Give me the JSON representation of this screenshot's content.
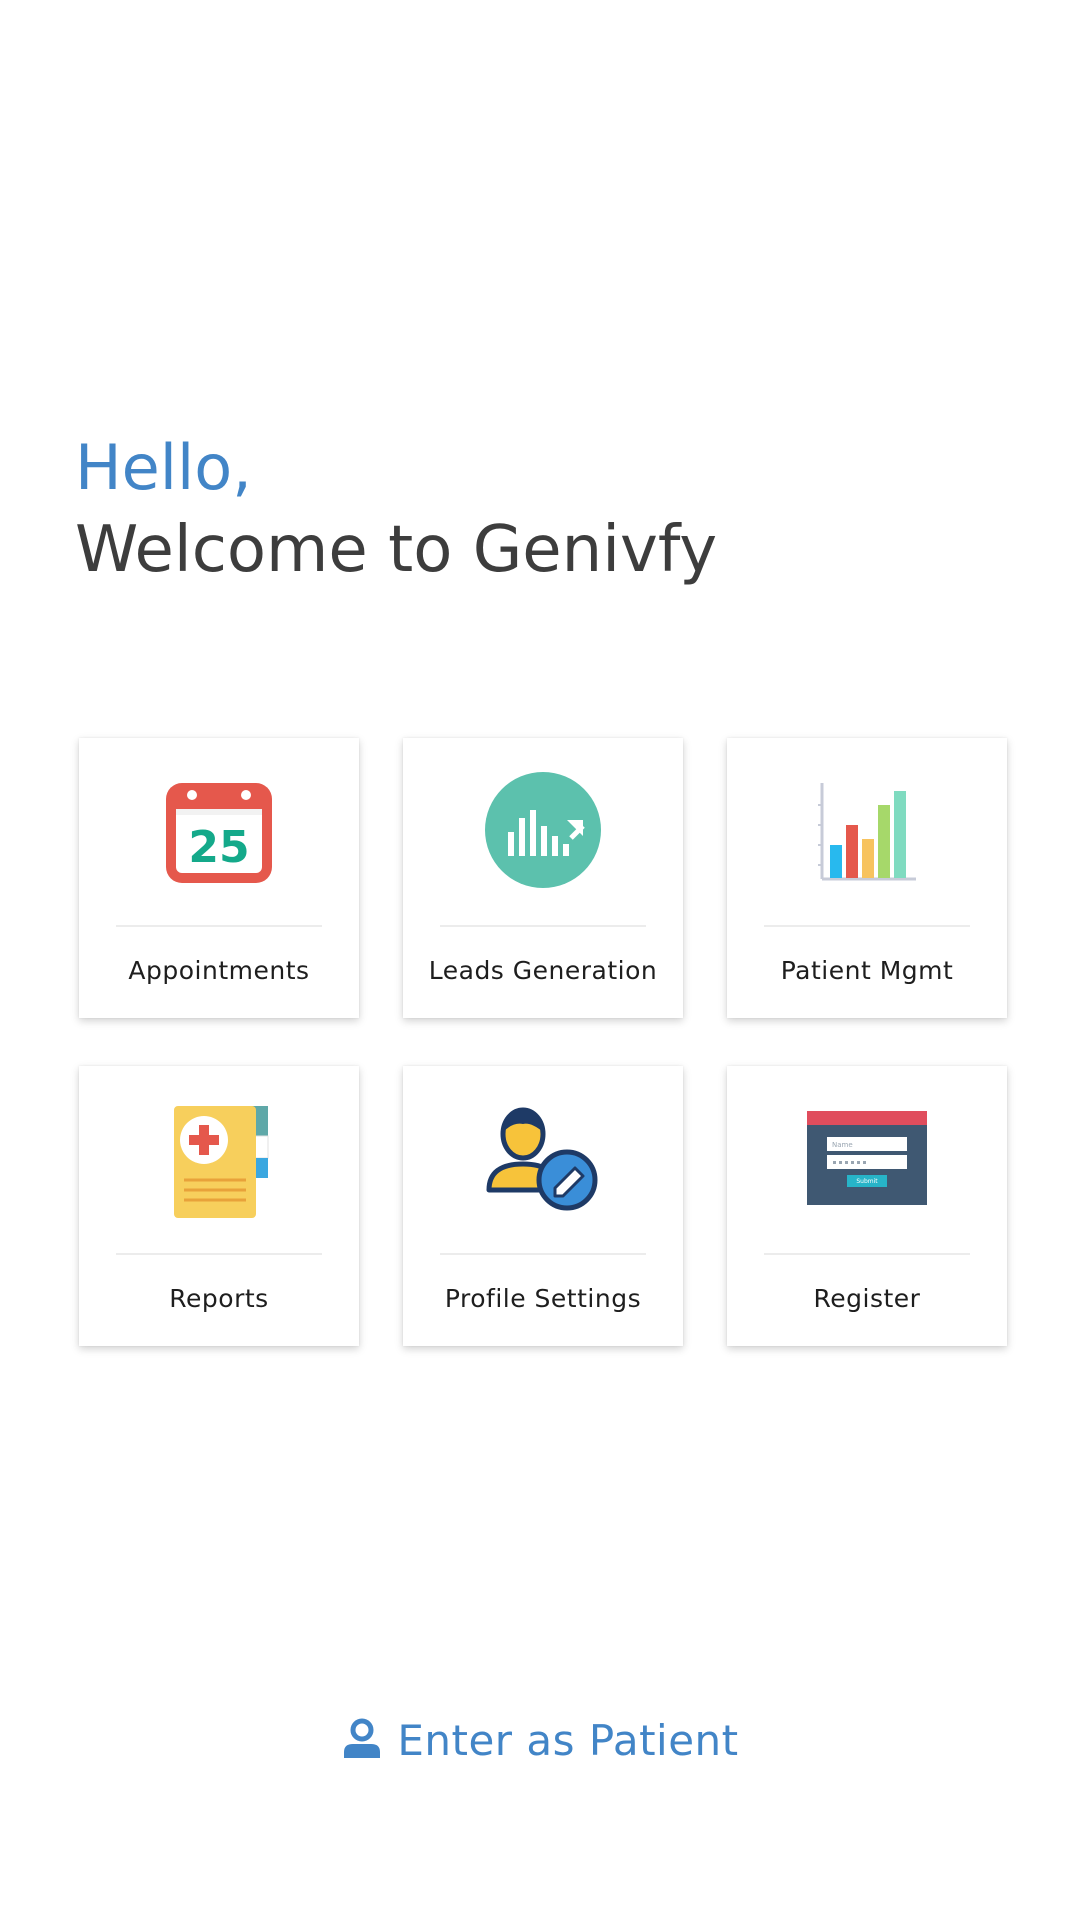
{
  "greeting": {
    "hello": "Hello,",
    "welcome": "Welcome to Genivfy"
  },
  "colors": {
    "accent": "#4285c7",
    "heading": "#3d3d3d"
  },
  "tiles": [
    {
      "label": "Appointments",
      "icon": "calendar-icon",
      "calendar_day": "25"
    },
    {
      "label": "Leads Generation",
      "icon": "leads-chart-icon"
    },
    {
      "label": "Patient Mgmt",
      "icon": "bar-chart-icon"
    },
    {
      "label": "Reports",
      "icon": "medical-report-icon"
    },
    {
      "label": "Profile Settings",
      "icon": "user-edit-icon"
    },
    {
      "label": "Register",
      "icon": "register-form-icon",
      "form_placeholder": "Name",
      "form_button": "Submit"
    }
  ],
  "footer": {
    "enter_patient_label": "Enter as Patient",
    "icon": "person-icon"
  }
}
